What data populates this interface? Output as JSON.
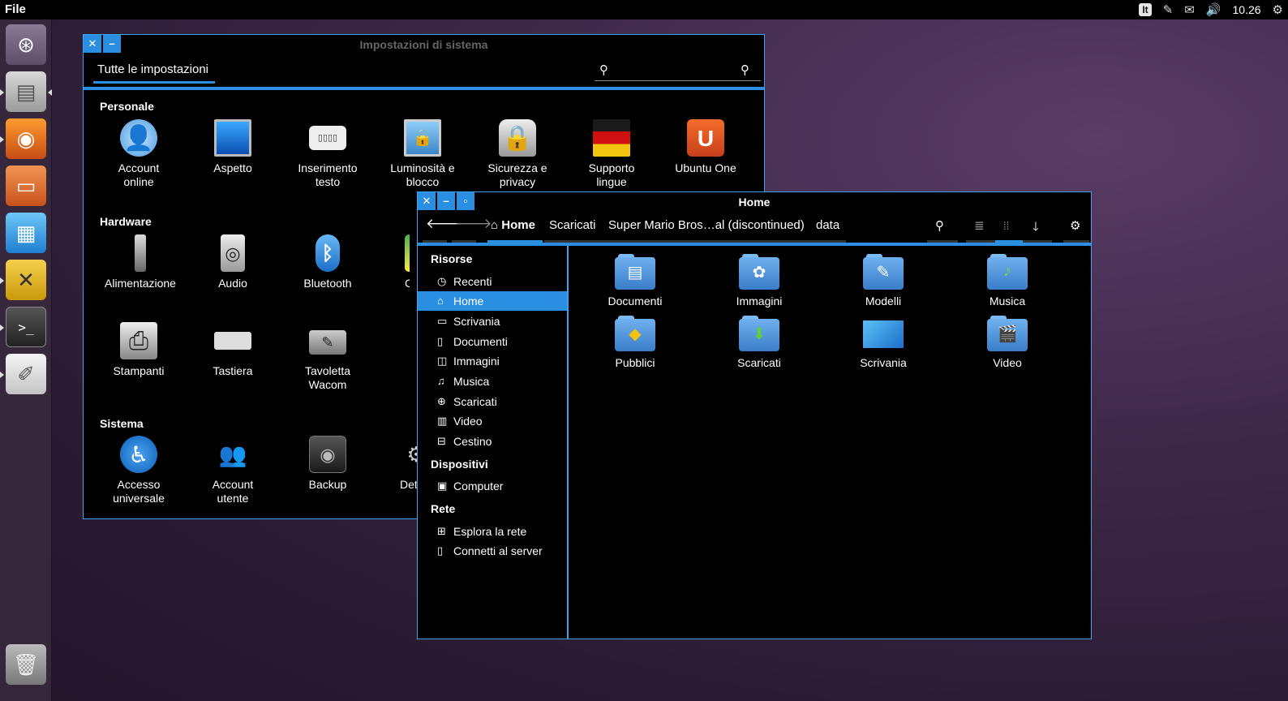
{
  "top_panel": {
    "app_menu": "File",
    "keyboard_layout": "It",
    "clock": "10.26"
  },
  "settings_window": {
    "title": "Impostazioni di sistema",
    "tab": "Tutte le impostazioni",
    "sections": {
      "personal": "Personale",
      "hardware": "Hardware",
      "system": "Sistema"
    },
    "personal_items": [
      {
        "label": "Account\nonline",
        "icon": "online-accounts-icon"
      },
      {
        "label": "Aspetto",
        "icon": "appearance-icon"
      },
      {
        "label": "Inserimento\ntesto",
        "icon": "text-entry-icon"
      },
      {
        "label": "Luminosità e\nblocco",
        "icon": "brightness-lock-icon"
      },
      {
        "label": "Sicurezza e\nprivacy",
        "icon": "security-privacy-icon"
      },
      {
        "label": "Supporto\nlingue",
        "icon": "language-support-icon"
      },
      {
        "label": "Ubuntu One",
        "icon": "ubuntu-one-icon"
      }
    ],
    "hardware_items": [
      {
        "label": "Alimentazione",
        "icon": "power-icon"
      },
      {
        "label": "Audio",
        "icon": "audio-icon"
      },
      {
        "label": "Bluetooth",
        "icon": "bluetooth-icon"
      },
      {
        "label": "Co",
        "icon": "color-icon"
      },
      {
        "label": "Stampanti",
        "icon": "printer-icon"
      },
      {
        "label": "Tastiera",
        "icon": "keyboard-icon"
      },
      {
        "label": "Tavoletta\nWacom",
        "icon": "wacom-tablet-icon"
      }
    ],
    "system_items": [
      {
        "label": "Accesso\nuniversale",
        "icon": "universal-access-icon"
      },
      {
        "label": "Account\nutente",
        "icon": "user-accounts-icon"
      },
      {
        "label": "Backup",
        "icon": "backup-icon"
      },
      {
        "label": "Det",
        "icon": "details-icon"
      }
    ]
  },
  "home_window": {
    "title": "Home",
    "breadcrumbs": [
      "Home",
      "Scaricati",
      "Super Mario Bros…al (discontinued)",
      "data"
    ],
    "sidebar": {
      "places_heading": "Risorse",
      "places": [
        {
          "label": "Recenti",
          "icon": "clock-icon"
        },
        {
          "label": "Home",
          "icon": "home-icon"
        },
        {
          "label": "Scrivania",
          "icon": "desktop-icon"
        },
        {
          "label": "Documenti",
          "icon": "documents-icon"
        },
        {
          "label": "Immagini",
          "icon": "pictures-icon"
        },
        {
          "label": "Musica",
          "icon": "music-icon"
        },
        {
          "label": "Scaricati",
          "icon": "downloads-icon"
        },
        {
          "label": "Video",
          "icon": "video-icon"
        },
        {
          "label": "Cestino",
          "icon": "trash-icon"
        }
      ],
      "devices_heading": "Dispositivi",
      "devices": [
        {
          "label": "Computer",
          "icon": "computer-icon"
        }
      ],
      "network_heading": "Rete",
      "network": [
        {
          "label": "Esplora la rete",
          "icon": "network-icon"
        },
        {
          "label": "Connetti al server",
          "icon": "server-icon"
        }
      ]
    },
    "files": [
      {
        "label": "Documenti",
        "icon": "documents-folder-icon"
      },
      {
        "label": "Immagini",
        "icon": "pictures-folder-icon"
      },
      {
        "label": "Modelli",
        "icon": "templates-folder-icon"
      },
      {
        "label": "Musica",
        "icon": "music-folder-icon"
      },
      {
        "label": "Pubblici",
        "icon": "public-folder-icon"
      },
      {
        "label": "Scaricati",
        "icon": "downloads-folder-icon"
      },
      {
        "label": "Scrivania",
        "icon": "desktop-folder-icon"
      },
      {
        "label": "Video",
        "icon": "video-folder-icon"
      }
    ]
  }
}
